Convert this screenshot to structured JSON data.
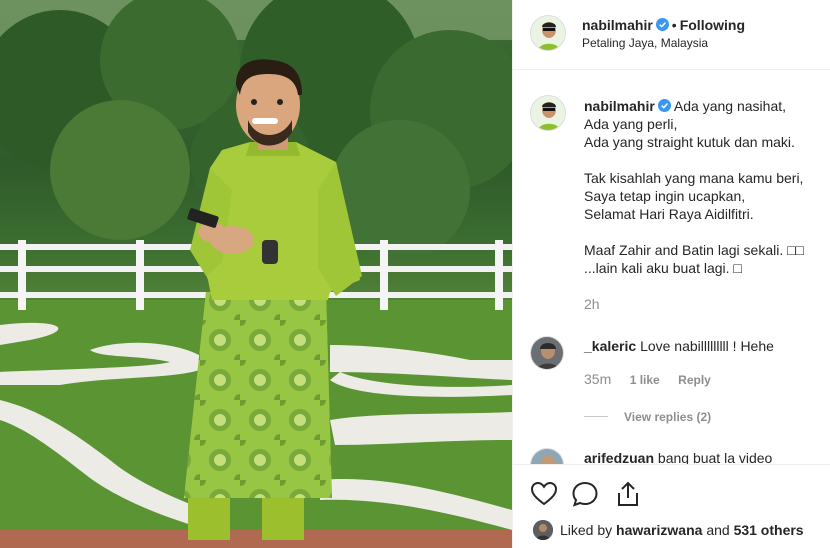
{
  "post": {
    "username": "nabilmahir",
    "follow_status": "Following",
    "location": "Petaling Jaya, Malaysia",
    "verified": true
  },
  "caption": {
    "username": "nabilmahir",
    "text": "Ada yang nasihat,\nAda yang perli,\nAda yang straight kutuk dan maki.\n\nTak kisahlah yang mana kamu beri,\nSaya tetap ingin ucapkan,\nSelamat Hari Raya Aidilfitri.\n\nMaaf Zahir and Batin lagi sekali. □□\n...lain kali aku buat lagi. □",
    "time": "2h"
  },
  "comments": [
    {
      "username": "_kaleric",
      "text": "Love nabilllllllll ! Hehe",
      "time": "35m",
      "likes": "1 like",
      "reply_label": "Reply",
      "view_replies": "View replies (2)"
    },
    {
      "username": "arifedzuan",
      "text": "bang buat la video"
    }
  ],
  "actions": {
    "like_icon": "heart-icon",
    "comment_icon": "comment-icon",
    "share_icon": "share-icon"
  },
  "likes": {
    "prefix": "Liked by",
    "user": "hawarizwana",
    "conjunction": "and",
    "others": "531 others"
  },
  "colors": {
    "verified": "#3897f0",
    "text": "#262626",
    "muted": "#8e8e8e",
    "outfit_green": "#a3c43a"
  }
}
